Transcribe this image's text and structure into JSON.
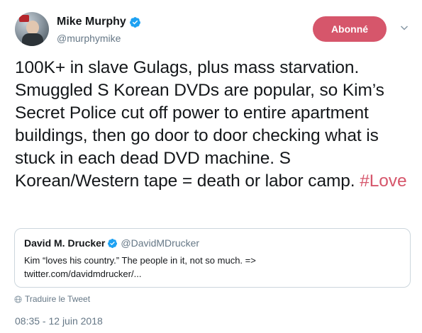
{
  "author": {
    "name": "Mike Murphy",
    "handle": "@murphymike",
    "avatar_icon": "user-avatar",
    "verified_icon": "verified-badge-icon"
  },
  "follow_button": {
    "label": "Abonné",
    "color": "#d6566b"
  },
  "tweet": {
    "text": "100K+ in slave Gulags, plus mass starvation. Smuggled S Korean DVDs are popular, so Kim’s Secret Police cut off power to entire apartment buildings, then go door to door checking what is stuck in each dead DVD machine. S Korean/Western tape = death or labor camp.",
    "hashtag": "#Love"
  },
  "quoted_tweet": {
    "name": "David M. Drucker",
    "handle": "@DavidMDrucker",
    "text_line1": "Kim “loves his country.” The people in it, not so much. =>",
    "text_line2": "twitter.com/davidmdrucker/..."
  },
  "translate_link": "Traduire le Tweet",
  "timestamp": "08:35 - 12 juin 2018",
  "colors": {
    "accent": "#d6566b",
    "verified": "#1da1f2",
    "muted": "#657786",
    "border": "#ccd6dd"
  }
}
